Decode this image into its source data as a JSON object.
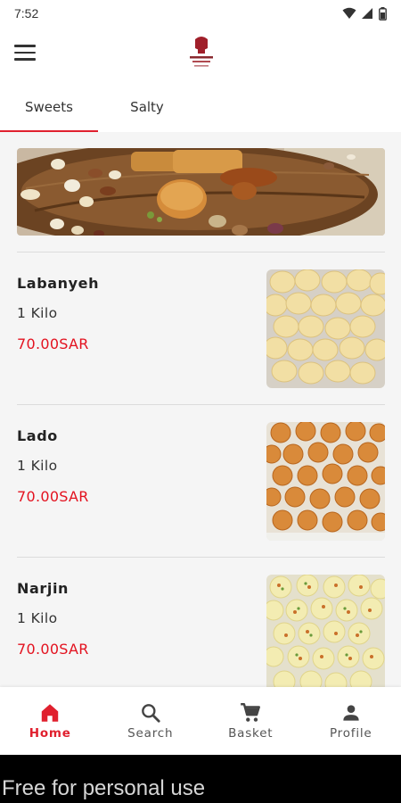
{
  "status_bar": {
    "time": "7:52"
  },
  "app_bar": {
    "menu_icon": "hamburger-menu-icon",
    "logo_icon": "brand-logo"
  },
  "tabs": [
    {
      "label": "Sweets",
      "active": true
    },
    {
      "label": "Salty",
      "active": false
    }
  ],
  "products": [
    {
      "name": "Labanyeh",
      "unit": "1 Kilo",
      "price": "70.00SAR"
    },
    {
      "name": "Lado",
      "unit": "1 Kilo",
      "price": "70.00SAR"
    },
    {
      "name": "Narjin",
      "unit": "1 Kilo",
      "price": "70.00SAR"
    }
  ],
  "bottom_nav": [
    {
      "label": "Home",
      "icon": "home-icon",
      "active": true
    },
    {
      "label": "Search",
      "icon": "search-icon",
      "active": false
    },
    {
      "label": "Basket",
      "icon": "cart-icon",
      "active": false
    },
    {
      "label": "Profile",
      "icon": "person-icon",
      "active": false
    }
  ],
  "watermark": "Free for personal use",
  "colors": {
    "accent": "#e0202e",
    "price": "#e3121f",
    "background": "#f5f5f5"
  }
}
